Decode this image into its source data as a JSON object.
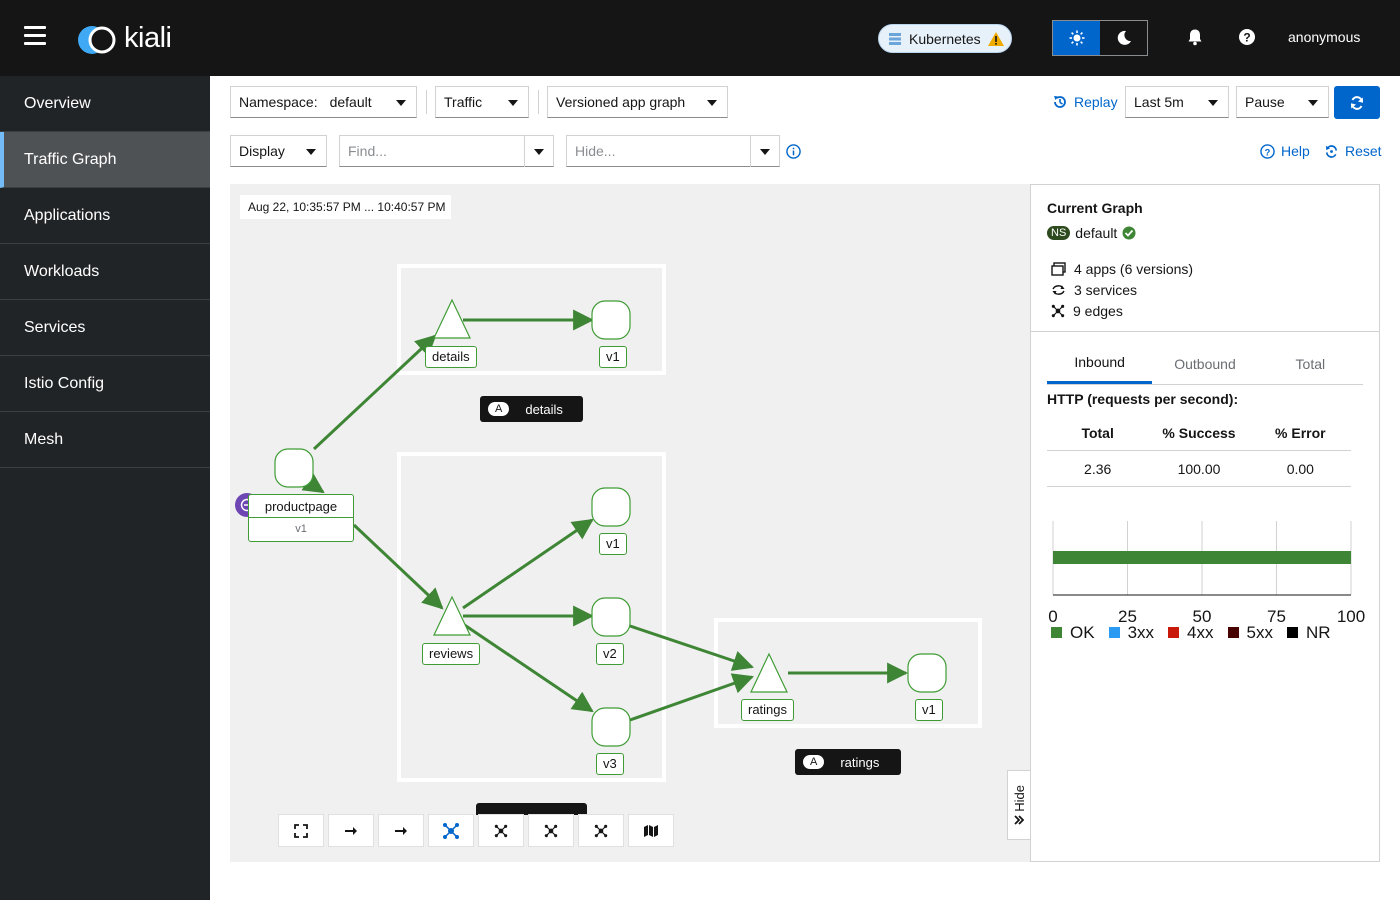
{
  "header": {
    "brand": "kiali",
    "cluster": "Kubernetes",
    "user": "anonymous"
  },
  "sidebar": {
    "items": [
      {
        "label": "Overview"
      },
      {
        "label": "Traffic Graph",
        "active": true
      },
      {
        "label": "Applications"
      },
      {
        "label": "Workloads"
      },
      {
        "label": "Services"
      },
      {
        "label": "Istio Config"
      },
      {
        "label": "Mesh"
      }
    ]
  },
  "toolbar": {
    "namespace_label": "Namespace:",
    "namespace_value": "default",
    "traffic": "Traffic",
    "graph_type": "Versioned app graph",
    "replay": "Replay",
    "duration": "Last 5m",
    "refresh": "Pause",
    "display": "Display",
    "find_placeholder": "Find...",
    "hide_placeholder": "Hide...",
    "help": "Help",
    "reset": "Reset"
  },
  "graph": {
    "timestamp": "Aug 22, 10:35:57 PM ... 10:40:57 PM",
    "nodes": {
      "productpage": "productpage",
      "productpage_version": "v1",
      "details": "details",
      "details_v1": "v1",
      "reviews": "reviews",
      "reviews_v1": "v1",
      "reviews_v2": "v2",
      "reviews_v3": "v3",
      "ratings": "ratings",
      "ratings_v1": "v1"
    },
    "app_boxes": {
      "details_badge": "A",
      "details": "details",
      "ratings_badge": "A",
      "ratings": "ratings"
    },
    "edge_color": "#3e8635",
    "node_border_color": "#3f9c35"
  },
  "side_panel": {
    "title": "Current Graph",
    "ns_tag": "NS",
    "namespace": "default",
    "apps": "4 apps (6 versions)",
    "services": "3 services",
    "edges": "9 edges",
    "tabs": [
      {
        "label": "Inbound",
        "active": true
      },
      {
        "label": "Outbound"
      },
      {
        "label": "Total"
      }
    ],
    "http_title": "HTTP (requests per second):",
    "table_headers": [
      "Total",
      "% Success",
      "% Error"
    ],
    "table_row": [
      "2.36",
      "100.00",
      "0.00"
    ],
    "hide_label": "Hide"
  },
  "chart_data": {
    "type": "bar",
    "orientation": "horizontal",
    "categories": [
      ""
    ],
    "series": [
      {
        "name": "OK",
        "values": [
          100
        ],
        "color": "#3e8635"
      },
      {
        "name": "3xx",
        "values": [
          0
        ],
        "color": "#2b9af3"
      },
      {
        "name": "4xx",
        "values": [
          0
        ],
        "color": "#c9190b"
      },
      {
        "name": "5xx",
        "values": [
          0
        ],
        "color": "#470000"
      },
      {
        "name": "NR",
        "values": [
          0
        ],
        "color": "#000000"
      }
    ],
    "xlim": [
      0,
      100
    ],
    "xticks": [
      "0",
      "25",
      "50",
      "75",
      "100"
    ],
    "legend": "bottom",
    "grid": true
  }
}
